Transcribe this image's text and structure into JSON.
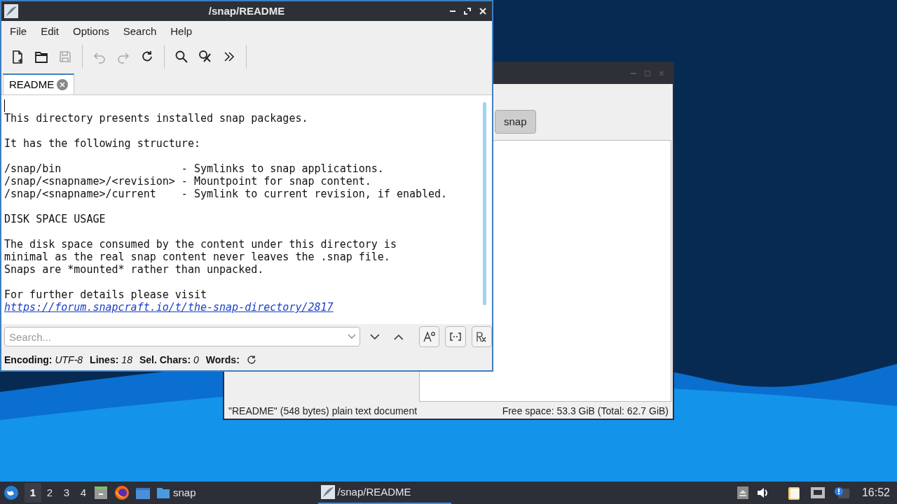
{
  "back_window": {
    "path_button": "snap",
    "status_left": "\"README\" (548 bytes) plain text document",
    "status_right": "Free space: 53.3 GiB (Total: 62.7 GiB)"
  },
  "editor": {
    "title": "/snap/README",
    "menu": [
      "File",
      "Edit",
      "Options",
      "Search",
      "Help"
    ],
    "toolbar": [
      {
        "disabled": false
      },
      {
        "disabled": false
      },
      {
        "disabled": true
      },
      {
        "disabled": true
      },
      {
        "disabled": true
      },
      {
        "disabled": false
      },
      {
        "disabled": false
      },
      {
        "disabled": false
      },
      {
        "disabled": false
      }
    ],
    "tabs": [
      {
        "label": "README",
        "selected": true
      }
    ],
    "paragraphs": [
      [
        "This directory presents installed snap packages."
      ],
      [
        "It has the following structure:"
      ],
      [
        "/snap/bin                   - Symlinks to snap applications.",
        "/snap/<snapname>/<revision> - Mountpoint for snap content.",
        "/snap/<snapname>/current    - Symlink to current revision, if enabled."
      ],
      [
        "DISK SPACE USAGE"
      ],
      [
        "The disk space consumed by the content under this directory is",
        "minimal as the real snap content never leaves the .snap file.",
        "Snaps are *mounted* rather than unpacked."
      ],
      [
        "For further details please visit"
      ]
    ],
    "link": "https://forum.snapcraft.io/t/the-snap-directory/2817",
    "search": {
      "placeholder": "Search..."
    },
    "status": [
      {
        "label": "Encoding:",
        "value": "UTF-8"
      },
      {
        "label": "Lines:",
        "value": "18"
      },
      {
        "label": "Sel. Chars:",
        "value": "0"
      },
      {
        "label": "Words:"
      }
    ]
  },
  "taskbar": {
    "workspaces": [
      {
        "label": "1",
        "selected": true
      },
      {
        "label": "2",
        "selected": false
      },
      {
        "label": "3",
        "selected": false
      },
      {
        "label": "4",
        "selected": false
      }
    ],
    "tasks": [
      {
        "label": "snap",
        "selected": false
      },
      {
        "label": "/snap/README",
        "selected": true
      }
    ],
    "clock": "16:52"
  }
}
